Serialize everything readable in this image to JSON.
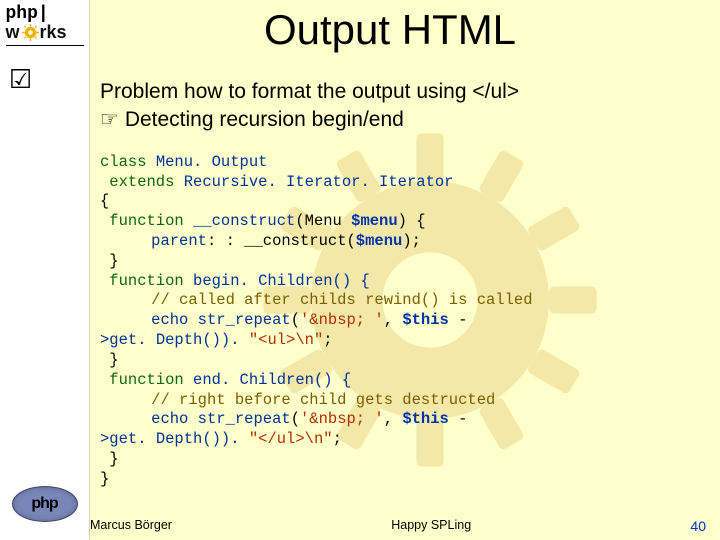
{
  "logo": {
    "line1": "php|",
    "line2_pre": "w",
    "line2_post": "rks",
    "bottom": "php"
  },
  "bullet_glyph": "☑",
  "title": "Output HTML",
  "problem_line1": "Problem how to format the output using </ul>",
  "problem_hand": "☞",
  "problem_line2": "Detecting recursion begin/end",
  "code": {
    "l01a": "class",
    "l01b": " Menu",
    "l01c": ". Output",
    "l02a": " extends",
    "l02b": " Recursive",
    "l02c": ". Iterator",
    "l02d": ". Iterator",
    "l03": "{",
    "l04a": " function",
    "l04b": " __construct",
    "l04c": "(Menu ",
    "l04d": "$menu",
    "l04e": ") {",
    "l05a": "parent",
    "l05b": ": : __construct(",
    "l05c": "$menu",
    "l05d": ");",
    "l06": " }",
    "l07a": " function",
    "l07b": " begin",
    "l07c": ". Children() {",
    "l08": "// called after childs rewind() is called",
    "l09a": "echo str_repeat",
    "l09b": "'&nbsp; '",
    "l09c": "$this",
    "l10a": ">get",
    "l10b": ". Depth()). ",
    "l10c": "\"<ul>\\n\"",
    "l10d": ";",
    "l11": " }",
    "l12a": " function",
    "l12b": " end",
    "l12c": ". Children() {",
    "l13": "// right before child gets destructed",
    "l14a": "echo str_repeat",
    "l14b": "'&nbsp; '",
    "l14c": "$this",
    "l15a": ">get",
    "l15b": ". Depth()). ",
    "l15c": "\"</ul>\\n\"",
    "l15d": ";",
    "l16": " }",
    "l17": "}"
  },
  "footer": {
    "left": "Marcus Börger",
    "center": "Happy SPLing",
    "right": "40"
  }
}
